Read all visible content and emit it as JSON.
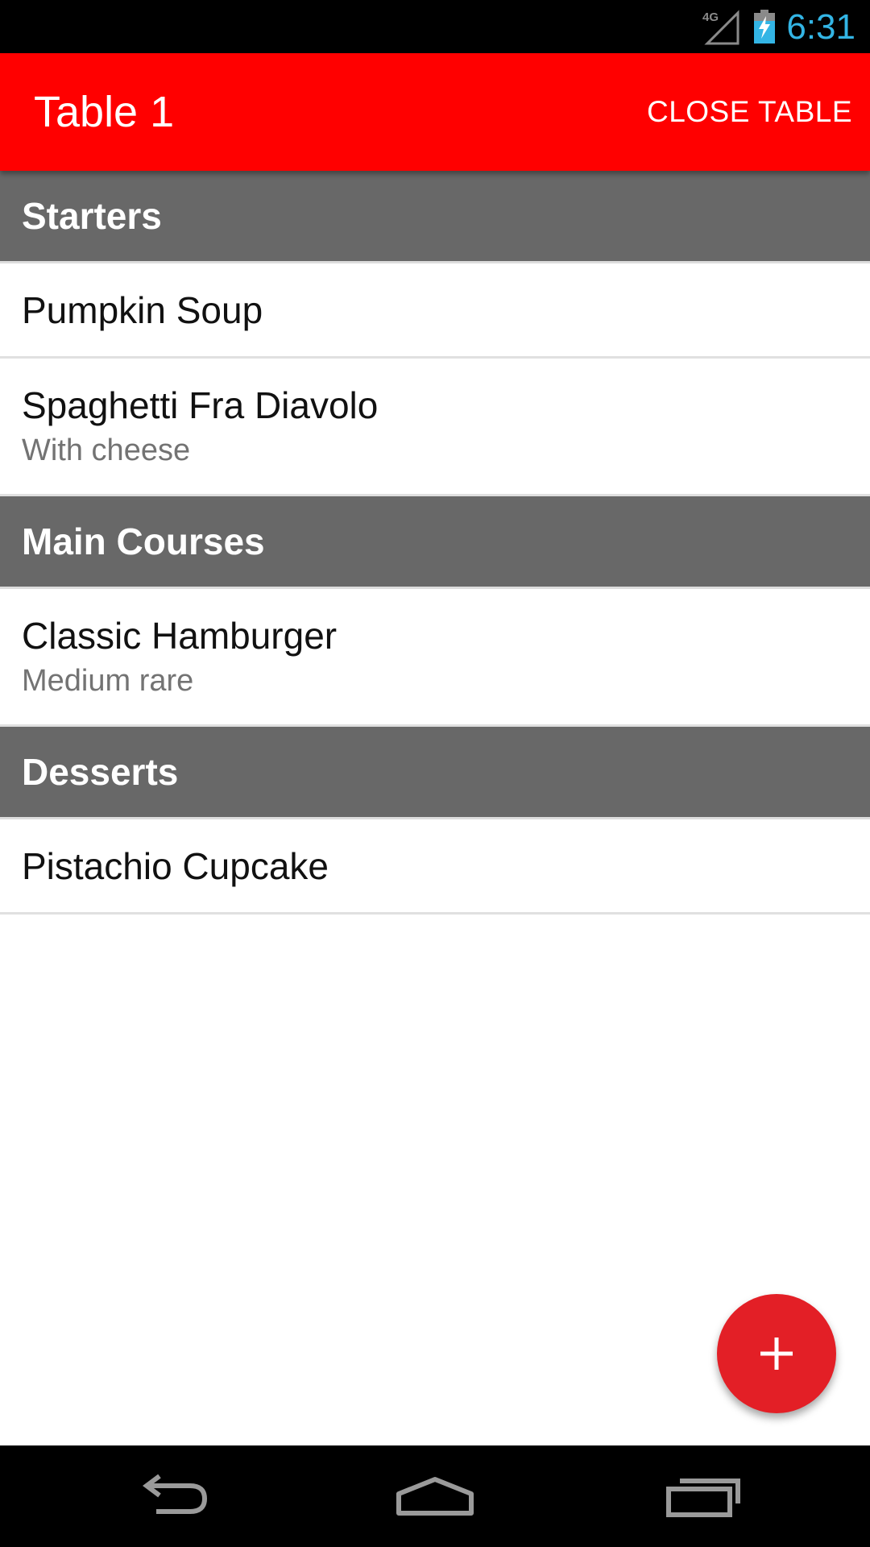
{
  "status_bar": {
    "network": "4G",
    "time": "6:31",
    "time_color": "#33b5e5",
    "icons": [
      "signal-icon",
      "battery-charging-icon"
    ]
  },
  "app_bar": {
    "title": "Table 1",
    "action_label": "CLOSE TABLE",
    "color": "#ff0000"
  },
  "sections": [
    {
      "title": "Starters",
      "items": [
        {
          "name": "Pumpkin Soup",
          "note": ""
        },
        {
          "name": "Spaghetti Fra Diavolo",
          "note": "With cheese"
        }
      ]
    },
    {
      "title": "Main Courses",
      "items": [
        {
          "name": "Classic Hamburger",
          "note": "Medium rare"
        }
      ]
    },
    {
      "title": "Desserts",
      "items": [
        {
          "name": "Pistachio Cupcake",
          "note": ""
        }
      ]
    }
  ],
  "fab": {
    "icon": "plus-icon",
    "color": "#e31f26"
  },
  "nav_bar": {
    "icons": [
      "back-icon",
      "home-icon",
      "recents-icon"
    ]
  }
}
